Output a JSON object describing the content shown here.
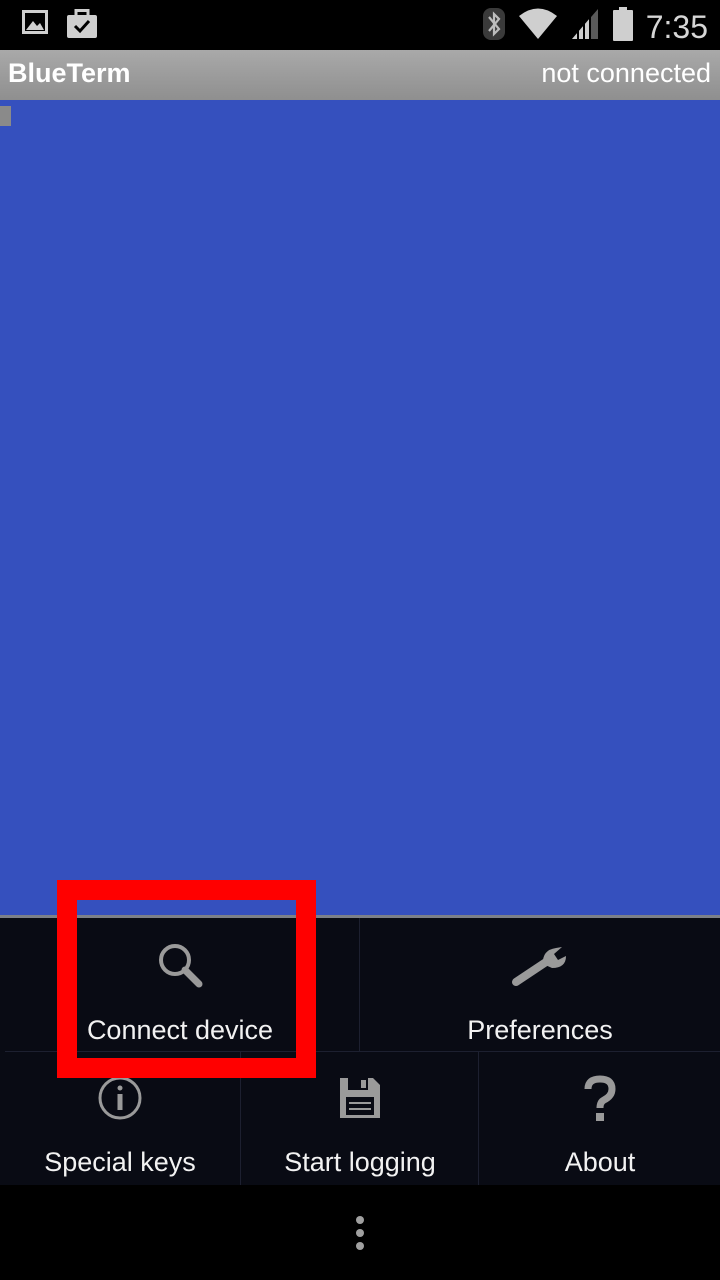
{
  "status_bar": {
    "time": "7:35",
    "icons": [
      "gallery-icon",
      "briefcase-icon",
      "bluetooth-icon",
      "wifi-icon",
      "signal-icon",
      "battery-icon"
    ]
  },
  "title_bar": {
    "app_title": "BlueTerm",
    "connection_status": "not connected"
  },
  "terminal": {
    "background_color": "#3550be"
  },
  "menu": {
    "items": [
      {
        "label": "Connect device",
        "icon": "search-icon"
      },
      {
        "label": "Preferences",
        "icon": "wrench-icon"
      },
      {
        "label": "Special keys",
        "icon": "info-icon"
      },
      {
        "label": "Start logging",
        "icon": "save-icon"
      },
      {
        "label": "About",
        "icon": "help-icon"
      }
    ]
  },
  "annotation": {
    "highlight_color": "#ff0000",
    "highlighted_item": "Connect device"
  },
  "nav_bar": {
    "icon": "overflow-menu-icon"
  }
}
